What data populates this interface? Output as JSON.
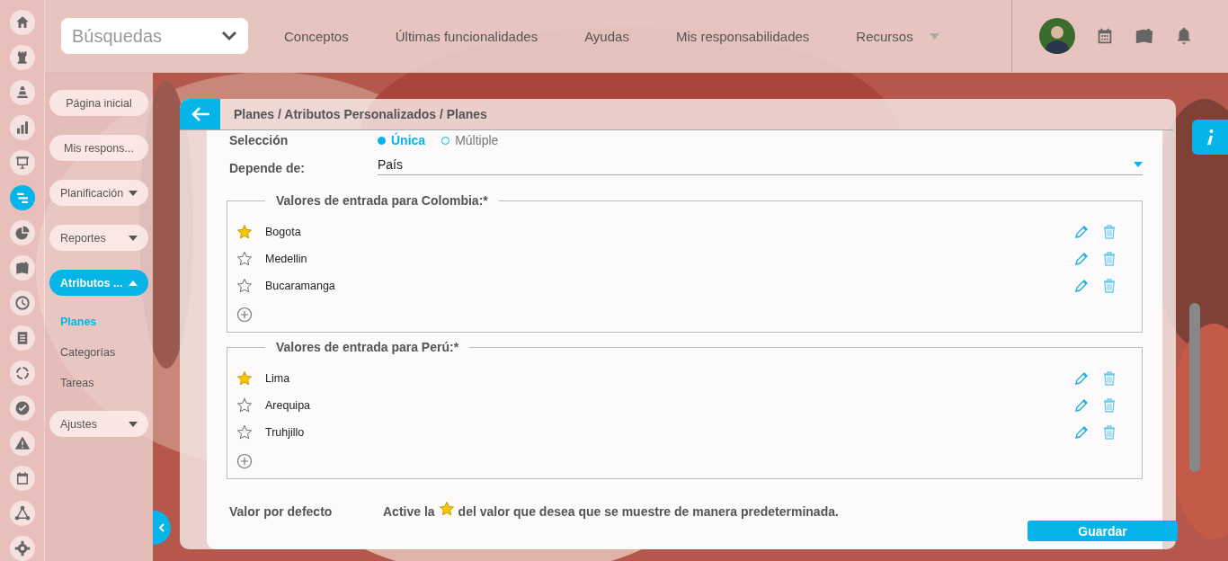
{
  "rail": [
    {
      "selected": false
    },
    {
      "selected": false
    },
    {
      "selected": false
    },
    {
      "selected": false
    },
    {
      "selected": false
    },
    {
      "selected": true
    },
    {
      "selected": false
    },
    {
      "selected": false
    },
    {
      "selected": false
    },
    {
      "selected": false
    },
    {
      "selected": false
    },
    {
      "selected": false
    },
    {
      "selected": false
    },
    {
      "selected": false
    },
    {
      "selected": false
    },
    {
      "selected": false
    }
  ],
  "search": {
    "value": "Búsquedas"
  },
  "nav": [
    {
      "label": "Conceptos"
    },
    {
      "label": "Últimas funcionalidades"
    },
    {
      "label": "Ayudas"
    },
    {
      "label": "Mis responsabilidades"
    },
    {
      "label": "Recursos"
    }
  ],
  "nav_more_caret": true,
  "sidebar": {
    "items": [
      {
        "label": "Página inicial",
        "kind": "button"
      },
      {
        "label": "Mis respons...",
        "kind": "button"
      },
      {
        "label": "Planificación",
        "kind": "menu",
        "expanded": false
      },
      {
        "label": "Reportes",
        "kind": "menu",
        "expanded": false
      },
      {
        "label": "Atributos ...",
        "kind": "menu",
        "expanded": true,
        "children": [
          {
            "label": "Planes",
            "selected": true
          },
          {
            "label": "Categorías",
            "selected": false
          },
          {
            "label": "Tareas",
            "selected": false
          }
        ]
      },
      {
        "label": "Ajustes",
        "kind": "menu",
        "expanded": false
      }
    ]
  },
  "breadcrumb": "Planes / Atributos Personalizados / Planes",
  "form": {
    "selection": {
      "label": "Selección",
      "options": [
        {
          "label": "Única",
          "selected": true
        },
        {
          "label": "Múltiple",
          "selected": false
        }
      ]
    },
    "depends_on": {
      "label": "Depende de:",
      "value": "País"
    },
    "groups": [
      {
        "title": "Valores de entrada para Colombia:*",
        "values": [
          {
            "label": "Bogota",
            "default": true
          },
          {
            "label": "Medellin",
            "default": false
          },
          {
            "label": "Bucaramanga",
            "default": false
          }
        ]
      },
      {
        "title": "Valores de entrada para Perú:*",
        "values": [
          {
            "label": "Lima",
            "default": true
          },
          {
            "label": "Arequipa",
            "default": false
          },
          {
            "label": "Truhjillo",
            "default": false
          }
        ]
      }
    ],
    "default_value": {
      "label": "Valor por defecto",
      "hint_before": "Active la",
      "hint_after": "del valor que desea que se muestre de manera predeterminada."
    }
  },
  "save_button": "Guardar"
}
